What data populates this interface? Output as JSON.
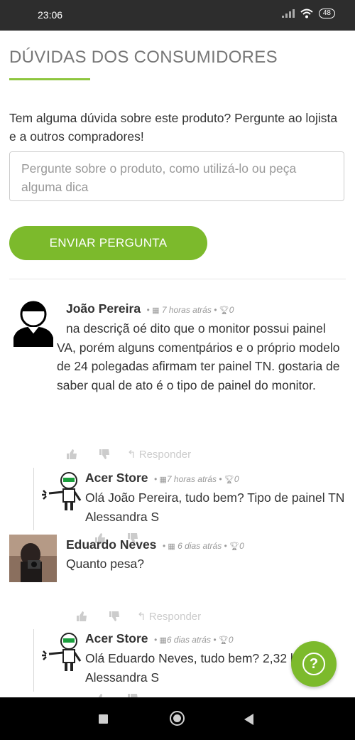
{
  "status_bar": {
    "time": "23:06",
    "signal": "|||",
    "battery": "48"
  },
  "section": {
    "title": "DÚVIDAS DOS CONSUMIDORES",
    "intro": "Tem alguma dúvida sobre este produto? Pergunte ao lojista e a outros compradores!",
    "input_placeholder": "Pergunte sobre o produto, como utilizá-lo ou peça alguma dica",
    "send_button": "ENVIAR PERGUNTA"
  },
  "comments": [
    {
      "name": "João Pereira",
      "time": "7 horas atrás",
      "separator": "•",
      "votes": "0",
      "text": "na descriçã oé dito que o monitor possui painel VA, porém alguns comentpários e o próprio modelo de 24 polegadas afirmam ter painel TN. gostaria de saber qual de ato é o tipo de painel do monitor.",
      "reply_label": "Responder",
      "reply": {
        "name": "Acer Store",
        "time": "7 horas atrás",
        "votes": "0",
        "text": "Olá João Pereira, tudo bem? Tipo de painel TN Alessandra S"
      }
    },
    {
      "name": "Eduardo Neves",
      "time": "6 dias atrás",
      "separator": "•",
      "votes": "0",
      "text": "Quanto pesa?",
      "reply_label": "Responder",
      "reply": {
        "name": "Acer Store",
        "time": "6 dias atrás",
        "votes": "0",
        "text": "Olá Eduardo Neves, tudo bem? 2,32 kg Alessandra S"
      }
    }
  ],
  "icons": {
    "calendar": "calendar-icon",
    "trophy": "trophy-icon",
    "thumb_up": "thumbs-up-icon",
    "thumb_down": "thumbs-down-icon",
    "reply": "reply-icon",
    "help": "question-icon"
  },
  "help_button": "?",
  "colors": {
    "accent": "#7cba2c",
    "title": "#777777",
    "status_bar": "#2d2d2d"
  }
}
